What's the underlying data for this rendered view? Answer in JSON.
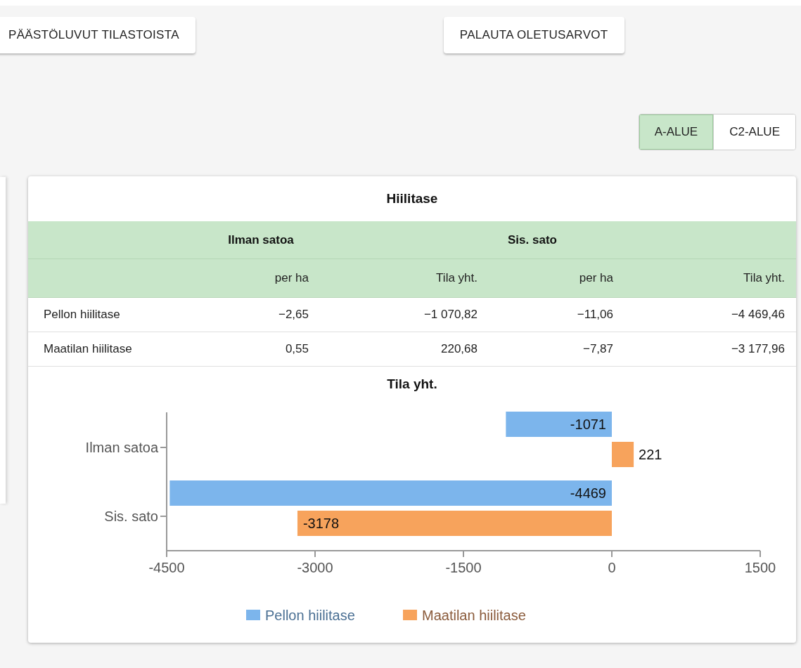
{
  "top_buttons": [
    {
      "label": "PÄÄSTÖLUVUT TILASTOISTA"
    },
    {
      "label": "PALAUTA OLETUSARVOT"
    }
  ],
  "area_toggle": [
    {
      "label": "A-ALUE",
      "selected": true
    },
    {
      "label": "C2-ALUE",
      "selected": false
    }
  ],
  "card": {
    "title": "Hiilitase",
    "group_headers": [
      "Ilman satoa",
      "Sis. sato"
    ],
    "columns": [
      "per ha",
      "Tila yht.",
      "per ha",
      "Tila yht."
    ],
    "rows": [
      {
        "label": "Pellon hiilitase",
        "cells": [
          "−2,65",
          "−1 070,82",
          "−11,06",
          "−4 469,46"
        ]
      },
      {
        "label": "Maatilan hiilitase",
        "cells": [
          "0,55",
          "220,68",
          "−7,87",
          "−3 177,96"
        ]
      }
    ],
    "chart_data": {
      "type": "bar",
      "orientation": "horizontal",
      "title": "Tila yht.",
      "categories": [
        "Ilman satoa",
        "Sis. sato"
      ],
      "series": [
        {
          "name": "Pellon hiilitase",
          "color": "#7cb5ec",
          "values": [
            -1071,
            -4469
          ]
        },
        {
          "name": "Maatilan hiilitase",
          "color": "#f7a35c",
          "values": [
            221,
            -3178
          ]
        }
      ],
      "xlim": [
        -4500,
        1500
      ],
      "xticks": [
        -4500,
        -3000,
        -1500,
        0,
        1500
      ],
      "data_labels": true,
      "legend": true
    }
  }
}
